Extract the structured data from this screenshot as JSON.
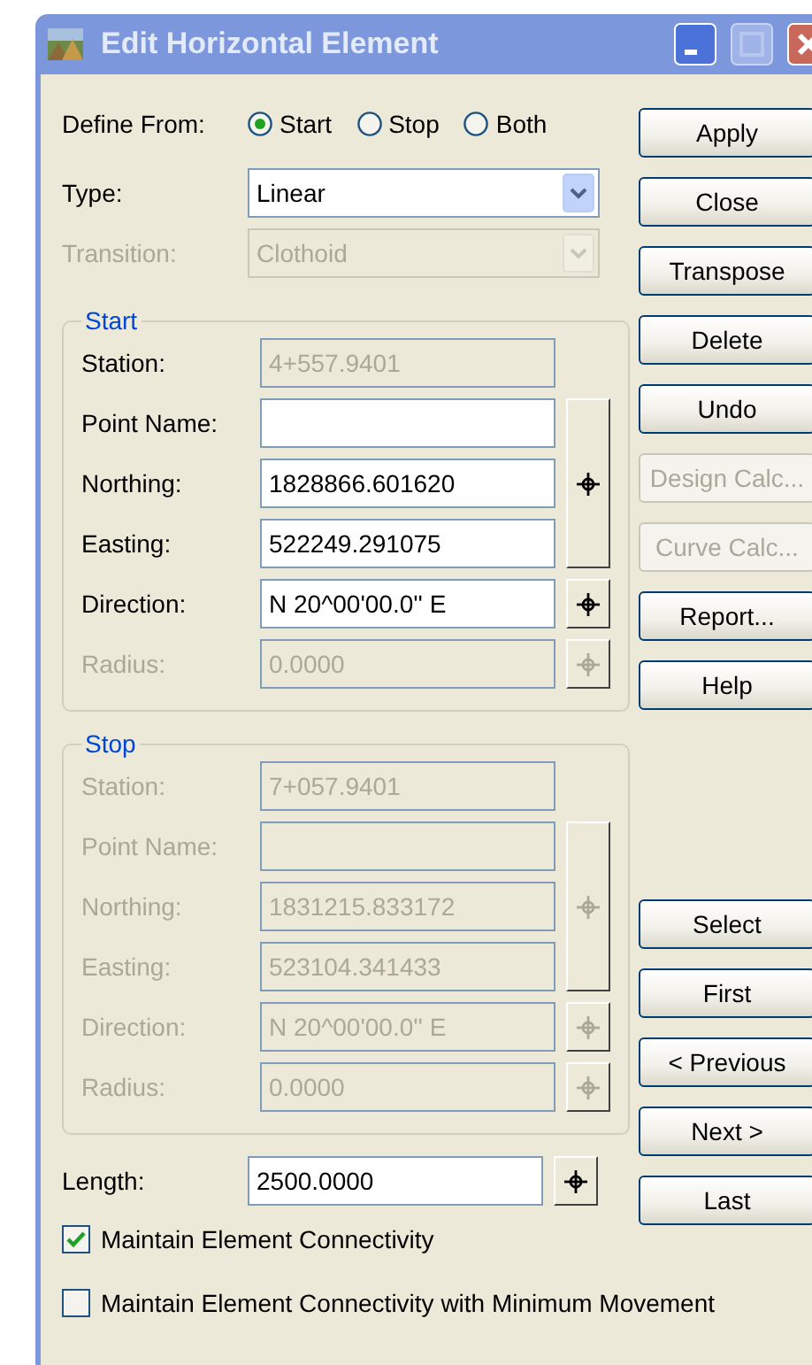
{
  "window": {
    "title": "Edit Horizontal Element",
    "controls": [
      {
        "kind": "minimize",
        "disabled": false
      },
      {
        "kind": "maximize",
        "disabled": true
      },
      {
        "kind": "close",
        "disabled": false
      }
    ]
  },
  "define_from": {
    "label": "Define From:",
    "options": [
      {
        "label": "Start",
        "selected": true
      },
      {
        "label": "Stop",
        "selected": false
      },
      {
        "label": "Both",
        "selected": false
      }
    ]
  },
  "type": {
    "label": "Type:",
    "value": "Linear",
    "disabled": false
  },
  "transition": {
    "label": "Transition:",
    "value": "Clothoid",
    "disabled": true
  },
  "sections": [
    {
      "title": "Start",
      "point_button": {
        "disabled": false
      },
      "fields": [
        {
          "label": "Station:",
          "value": "4+557.9401",
          "label_disabled": false,
          "disabled": true,
          "kind": "plain"
        },
        {
          "label": "Point Name:",
          "label_disabled": false,
          "disabled": false,
          "kind": "point"
        },
        {
          "label": "Northing:",
          "value": "1828866.601620",
          "label_disabled": false,
          "disabled": false,
          "kind": "point"
        },
        {
          "label": "Easting:",
          "value": "522249.291075",
          "label_disabled": false,
          "disabled": false,
          "kind": "point"
        },
        {
          "label": "Direction:",
          "value": "N 20^00'00.0'' E",
          "label_disabled": false,
          "disabled": false,
          "kind": "pick"
        },
        {
          "label": "Radius:",
          "value": "0.0000",
          "label_disabled": true,
          "disabled": true,
          "kind": "pick"
        }
      ]
    },
    {
      "title": "Stop",
      "point_button": {
        "disabled": true
      },
      "fields": [
        {
          "label": "Station:",
          "value": "7+057.9401",
          "label_disabled": true,
          "disabled": true,
          "kind": "plain"
        },
        {
          "label": "Point Name:",
          "label_disabled": true,
          "disabled": true,
          "kind": "point"
        },
        {
          "label": "Northing:",
          "value": "1831215.833172",
          "label_disabled": true,
          "disabled": true,
          "kind": "point"
        },
        {
          "label": "Easting:",
          "value": "523104.341433",
          "label_disabled": true,
          "disabled": true,
          "kind": "point"
        },
        {
          "label": "Direction:",
          "value": "N 20^00'00.0'' E",
          "label_disabled": true,
          "disabled": true,
          "kind": "pick"
        },
        {
          "label": "Radius:",
          "value": "0.0000",
          "label_disabled": true,
          "disabled": true,
          "kind": "pick"
        }
      ]
    }
  ],
  "length": {
    "label": "Length:",
    "value": "2500.0000",
    "disabled": false
  },
  "checkboxes": [
    {
      "label": "Maintain Element Connectivity",
      "checked": true
    },
    {
      "label": "Maintain Element Connectivity with Minimum Movement",
      "checked": false
    }
  ],
  "buttons": [
    {
      "label": "Apply",
      "disabled": false
    },
    {
      "label": "Close",
      "disabled": false
    },
    {
      "label": "Transpose",
      "disabled": false
    },
    {
      "label": "Delete",
      "disabled": false
    },
    {
      "label": "Undo",
      "disabled": false
    },
    {
      "label": "Design Calc...",
      "disabled": true
    },
    {
      "label": "Curve Calc...",
      "disabled": true
    },
    {
      "label": "Report...",
      "disabled": false
    },
    {
      "label": "Help",
      "disabled": false
    }
  ],
  "nav_buttons": [
    {
      "label": "Select",
      "disabled": false
    },
    {
      "label": "First",
      "disabled": false
    },
    {
      "label": "< Previous",
      "disabled": false
    },
    {
      "label": "Next >",
      "disabled": false
    },
    {
      "label": "Last",
      "disabled": false
    }
  ]
}
